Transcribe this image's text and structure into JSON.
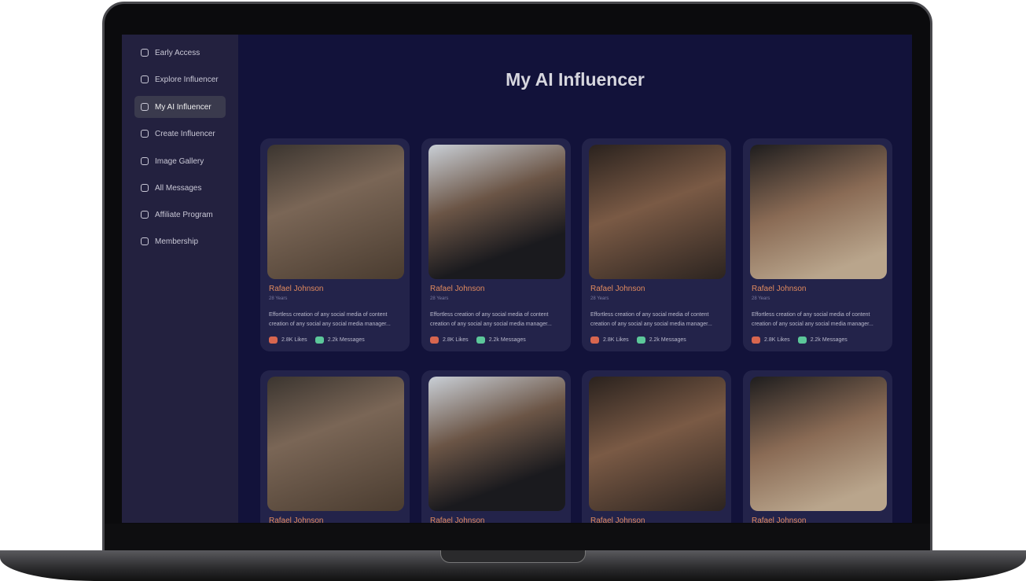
{
  "sidebar": {
    "items": [
      {
        "label": "Early Access",
        "icon": "home-icon"
      },
      {
        "label": "Explore Influencer",
        "icon": "scan-user-icon"
      },
      {
        "label": "My AI Influencer",
        "icon": "user-circle-icon",
        "active": true
      },
      {
        "label": "Create Influencer",
        "icon": "scan-user-icon"
      },
      {
        "label": "Image Gallery",
        "icon": "image-icon"
      },
      {
        "label": "All Messages",
        "icon": "message-icon"
      },
      {
        "label": "Affiliate Program",
        "icon": "copy-icon"
      },
      {
        "label": "Membership",
        "icon": "chart-icon"
      }
    ]
  },
  "page_title": "My AI Influencer",
  "cards": [
    {
      "name": "Rafael Johnson",
      "age": "28 Years",
      "description": "Effortless creation of any social media of content creation of any social any social media manager...",
      "likes": "2.8K Likes",
      "messages": "2.2k Messages"
    },
    {
      "name": "Rafael Johnson",
      "age": "28 Years",
      "description": "Effortless creation of any social media of content creation of any social any social media manager...",
      "likes": "2.8K Likes",
      "messages": "2.2k Messages"
    },
    {
      "name": "Rafael Johnson",
      "age": "28 Years",
      "description": "Effortless creation of any social media of content creation of any social any social media manager...",
      "likes": "2.8K Likes",
      "messages": "2.2k Messages"
    },
    {
      "name": "Rafael Johnson",
      "age": "28 Years",
      "description": "Effortless creation of any social media of content creation of any social any social media manager...",
      "likes": "2.8K Likes",
      "messages": "2.2k Messages"
    },
    {
      "name": "Rafael Johnson"
    },
    {
      "name": "Rafael Johnson"
    },
    {
      "name": "Rafael Johnson"
    },
    {
      "name": "Rafael Johnson"
    }
  ]
}
